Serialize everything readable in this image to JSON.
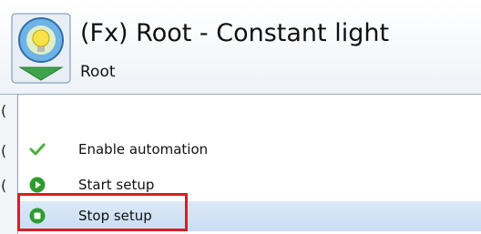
{
  "header": {
    "title": "(Fx) Root - Constant light",
    "subtitle": "Root",
    "icon": "lightbulb-gear-icon"
  },
  "left_edge": {
    "glyphs": [
      "(",
      "(",
      "("
    ]
  },
  "menu": {
    "items": [
      {
        "label": "Enable automation",
        "icon": "checkmark-icon",
        "icon_color": "#4caf3f",
        "selected": false
      },
      {
        "label": "Start setup",
        "icon": "play-circle-icon",
        "icon_color": "#2e9b2e",
        "selected": false
      },
      {
        "label": "Stop setup",
        "icon": "stop-circle-icon",
        "icon_color": "#2e9b2e",
        "selected": true
      }
    ]
  },
  "colors": {
    "highlight_border": "#e01a24",
    "selected_row": "#cfe2f4",
    "accent_green": "#2e9b2e"
  }
}
